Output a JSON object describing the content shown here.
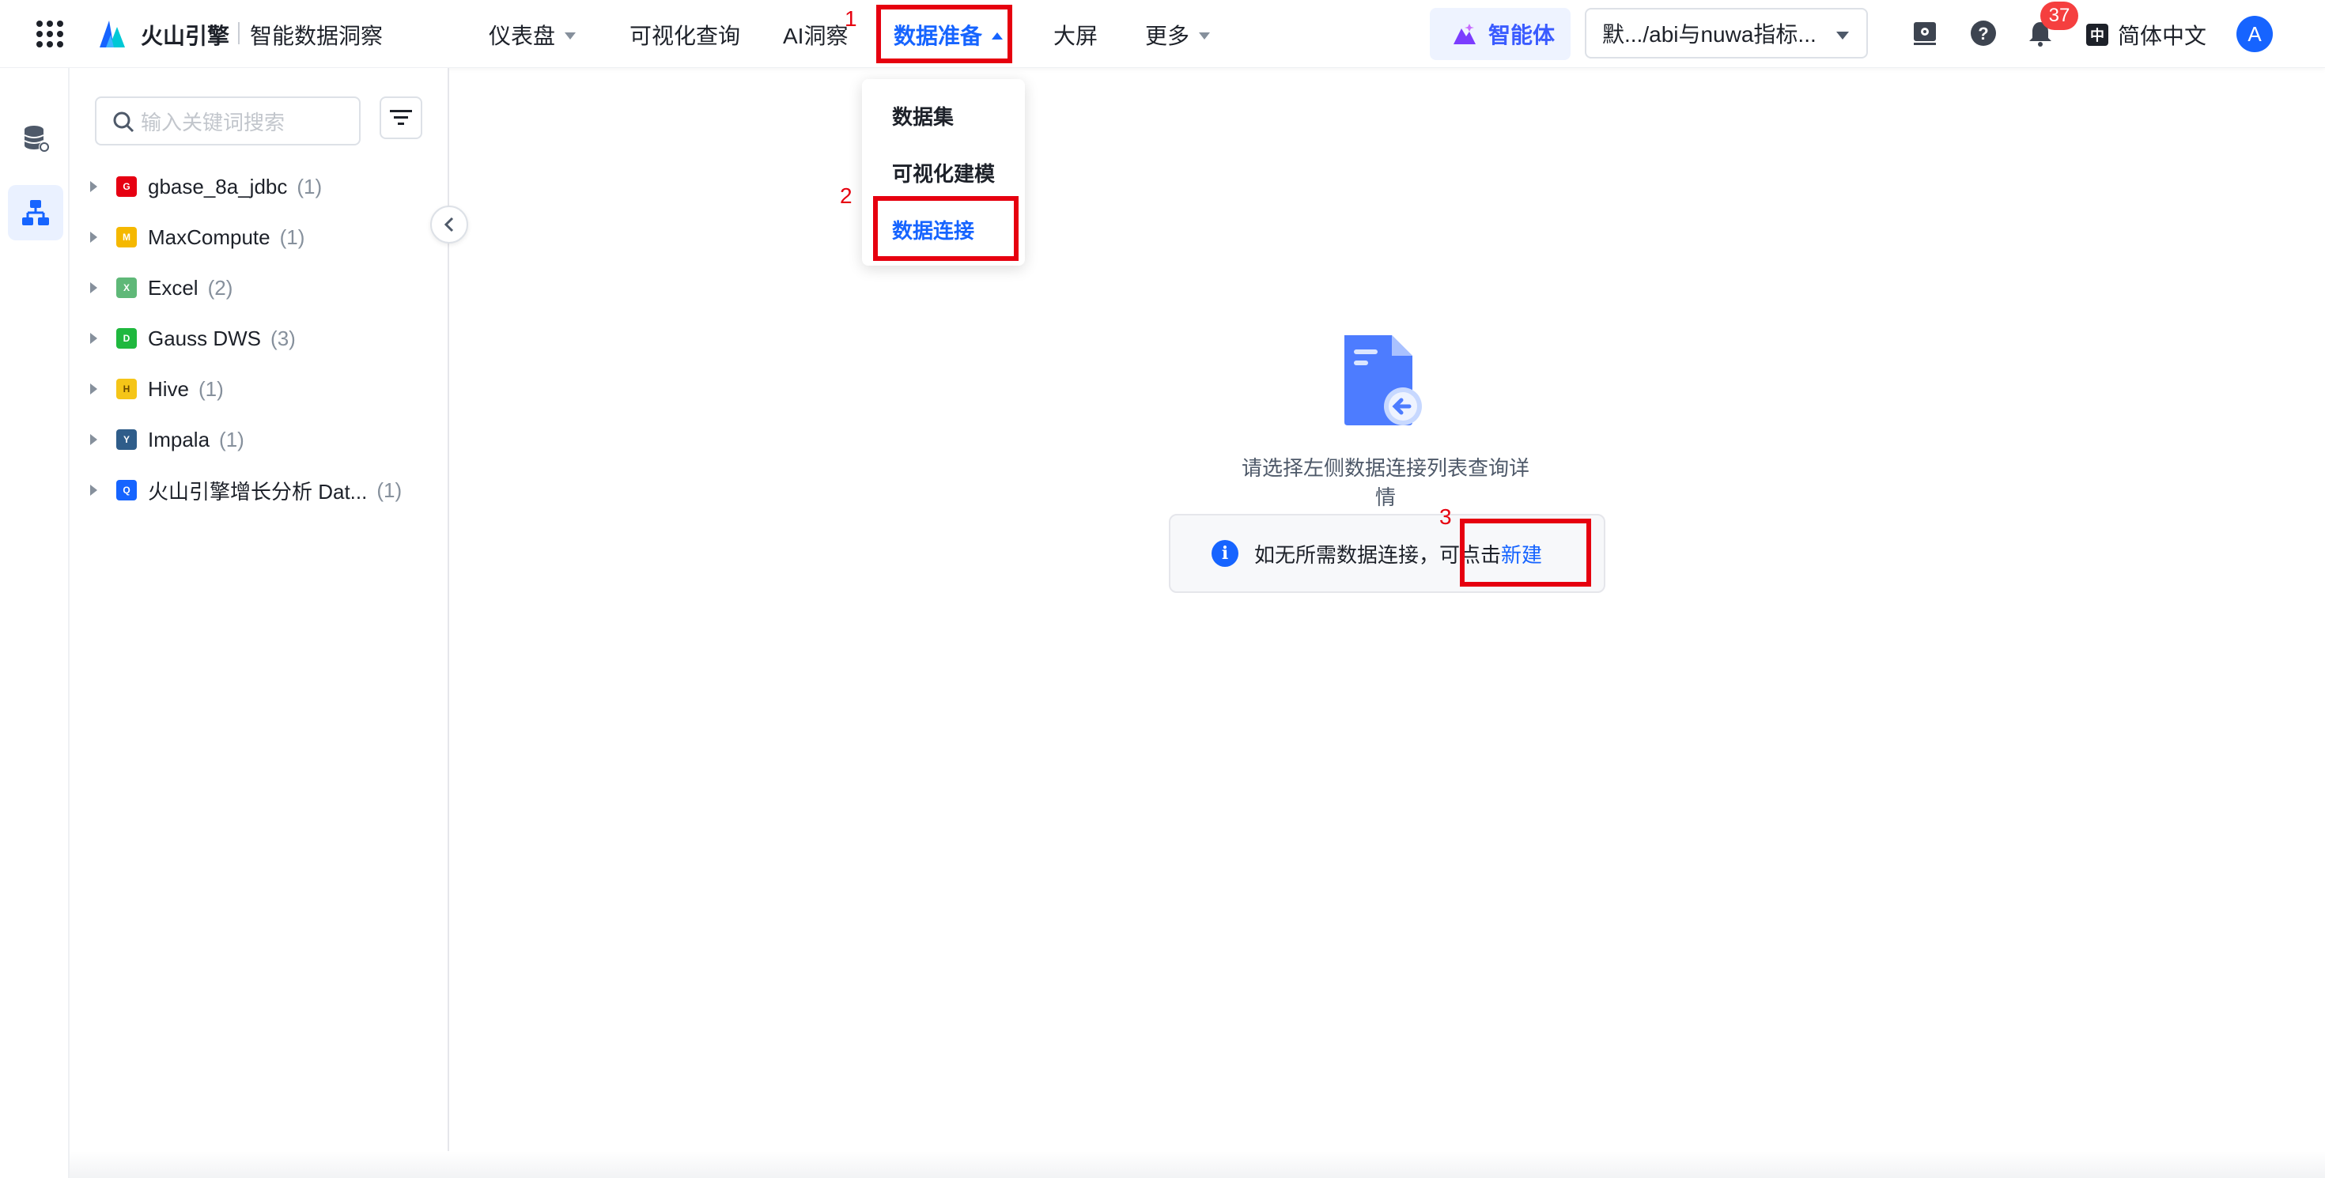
{
  "header": {
    "brand": "火山引擎",
    "product": "智能数据洞察",
    "nav": [
      {
        "label": "仪表盘",
        "has_caret": true
      },
      {
        "label": "可视化查询",
        "has_caret": false
      },
      {
        "label": "AI洞察",
        "has_caret": false
      },
      {
        "label": "数据准备",
        "has_caret": true,
        "active": true
      },
      {
        "label": "大屏",
        "has_caret": false
      },
      {
        "label": "更多",
        "has_caret": true
      }
    ],
    "agent_label": "智能体",
    "project_select": "默.../abi与nuwa指标...",
    "notification_count": "37",
    "language": "简体中文",
    "language_icon": "中",
    "avatar_initial": "A"
  },
  "annotations": {
    "step1": "1",
    "step2": "2",
    "step3": "3"
  },
  "dropdown": {
    "items": [
      {
        "label": "数据集"
      },
      {
        "label": "可视化建模"
      },
      {
        "label": "数据连接",
        "active": true
      }
    ]
  },
  "sidebar": {
    "search_placeholder": "输入关键词搜索",
    "connections": [
      {
        "name": "gbase_8a_jdbc",
        "count": "(1)",
        "icon": "gbase-icon",
        "color": "#e60012"
      },
      {
        "name": "MaxCompute",
        "count": "(1)",
        "icon": "maxcompute-icon",
        "color": "#f5b800"
      },
      {
        "name": "Excel",
        "count": "(2)",
        "icon": "excel-icon",
        "color": "#5fb878"
      },
      {
        "name": "Gauss DWS",
        "count": "(3)",
        "icon": "gauss-icon",
        "color": "#1fb83e"
      },
      {
        "name": "Hive",
        "count": "(1)",
        "icon": "hive-icon",
        "color": "#f5c518"
      },
      {
        "name": "Impala",
        "count": "(1)",
        "icon": "impala-icon",
        "color": "#2f5d8a"
      },
      {
        "name": "火山引擎增长分析 Dat...",
        "count": "(1)",
        "icon": "datafinder-icon",
        "color": "#1664ff"
      }
    ]
  },
  "main": {
    "empty_text": "请选择左侧数据连接列表查询详情",
    "hint_prefix": "如无所需数据连接，可点击",
    "hint_link": "新建"
  }
}
